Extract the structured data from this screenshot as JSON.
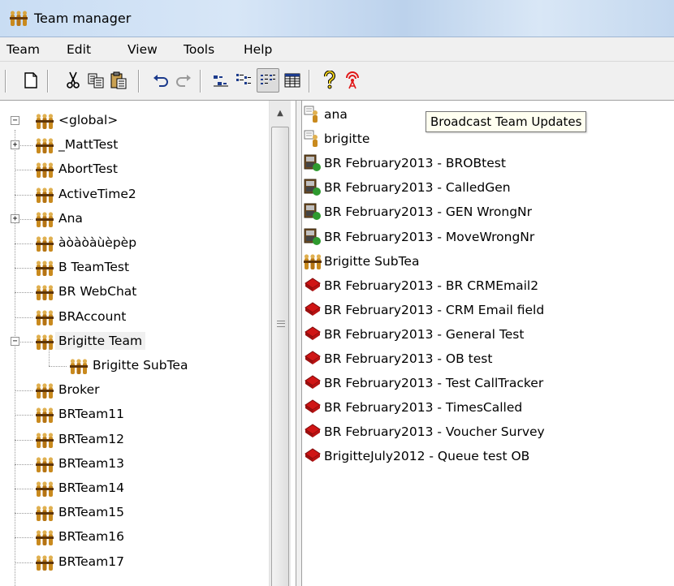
{
  "window": {
    "title": "Team manager"
  },
  "menu": {
    "items": [
      "Team",
      "Edit",
      "View",
      "Tools",
      "Help"
    ]
  },
  "toolbar": {
    "buttons": [
      "new-icon",
      "cut-icon",
      "copy-icon",
      "paste-icon",
      "undo-icon",
      "redo-icon",
      "small-icons-icon",
      "list-icon",
      "details-icon",
      "grid-icon",
      "help-icon",
      "broadcast-icon"
    ]
  },
  "tooltip": {
    "text": "Broadcast Team Updates"
  },
  "tree": {
    "root": "<global>",
    "items": [
      {
        "label": "_MattTest",
        "expander": "+"
      },
      {
        "label": "AbortTest",
        "expander": ""
      },
      {
        "label": "ActiveTime2",
        "expander": ""
      },
      {
        "label": "Ana",
        "expander": "+"
      },
      {
        "label": "àòàòàùèpèp",
        "expander": ""
      },
      {
        "label": "B TeamTest",
        "expander": ""
      },
      {
        "label": "BR WebChat",
        "expander": ""
      },
      {
        "label": "BRAccount",
        "expander": ""
      },
      {
        "label": "Brigitte Team",
        "expander": "−"
      },
      {
        "label": "Brigitte SubTea",
        "expander": ""
      },
      {
        "label": "Broker",
        "expander": ""
      },
      {
        "label": "BRTeam11",
        "expander": ""
      },
      {
        "label": "BRTeam12",
        "expander": ""
      },
      {
        "label": "BRTeam13",
        "expander": ""
      },
      {
        "label": "BRTeam14",
        "expander": ""
      },
      {
        "label": "BRTeam15",
        "expander": ""
      },
      {
        "label": "BRTeam16",
        "expander": ""
      },
      {
        "label": "BRTeam17",
        "expander": ""
      }
    ]
  },
  "list": {
    "items": [
      {
        "label": "ana",
        "icon": "agent-icon"
      },
      {
        "label": "brigitte",
        "icon": "agent-icon"
      },
      {
        "label": "BR February2013 - BROBtest",
        "icon": "campaign-icon"
      },
      {
        "label": "BR February2013 - CalledGen",
        "icon": "campaign-icon"
      },
      {
        "label": "BR February2013 - GEN WrongNr",
        "icon": "campaign-icon"
      },
      {
        "label": "BR February2013 - MoveWrongNr",
        "icon": "campaign-icon"
      },
      {
        "label": "Brigitte SubTea",
        "icon": "team-icon"
      },
      {
        "label": "BR February2013 - BR CRMEmail2",
        "icon": "queue-icon"
      },
      {
        "label": "BR February2013 - CRM Email field",
        "icon": "queue-icon"
      },
      {
        "label": "BR February2013 - General Test",
        "icon": "queue-icon"
      },
      {
        "label": "BR February2013 - OB test",
        "icon": "queue-icon"
      },
      {
        "label": "BR February2013 - Test CallTracker",
        "icon": "queue-icon"
      },
      {
        "label": "BR February2013 - TimesCalled",
        "icon": "queue-icon"
      },
      {
        "label": "BR February2013 - Voucher Survey",
        "icon": "queue-icon"
      },
      {
        "label": "BrigitteJuly2012 - Queue test OB",
        "icon": "queue-icon"
      }
    ]
  },
  "colors": {
    "accent": "#c9ddf3",
    "tooltip_bg": "#fffff0",
    "broadcast": "#e01818"
  }
}
